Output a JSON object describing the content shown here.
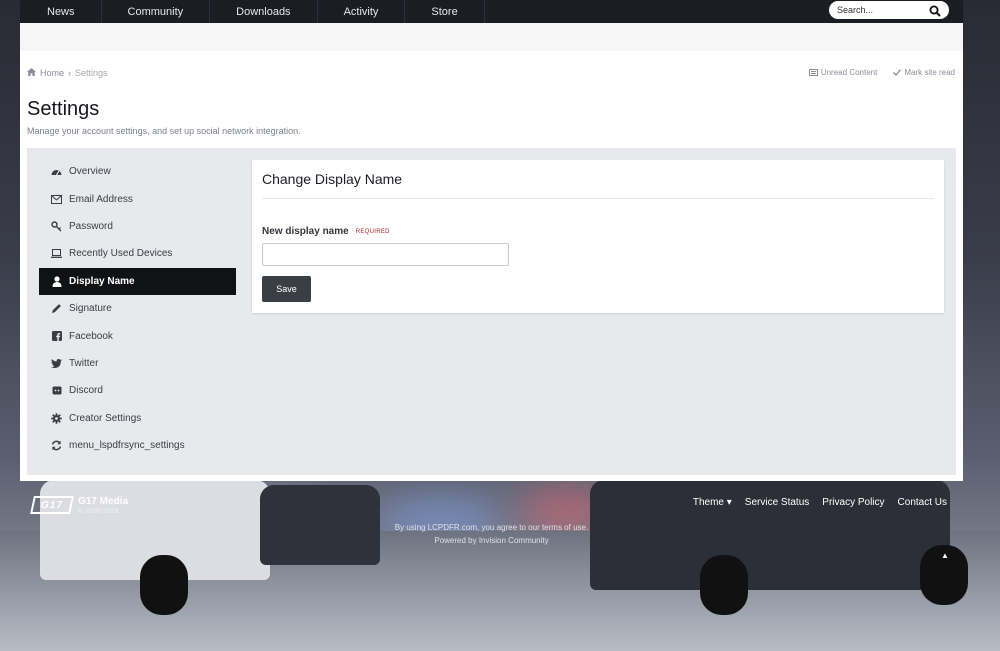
{
  "nav": {
    "items": [
      "News",
      "Community",
      "Downloads",
      "Activity",
      "Store"
    ],
    "search_placeholder": "Search..."
  },
  "breadcrumb": {
    "home": "Home",
    "current": "Settings",
    "unread_content": "Unread Content",
    "mark_site_read": "Mark site read"
  },
  "page": {
    "title": "Settings",
    "description": "Manage your account settings, and set up social network integration."
  },
  "sidebar": {
    "items": [
      {
        "label": "Overview",
        "icon": "dashboard-icon"
      },
      {
        "label": "Email Address",
        "icon": "envelope-icon"
      },
      {
        "label": "Password",
        "icon": "key-icon"
      },
      {
        "label": "Recently Used Devices",
        "icon": "laptop-icon"
      },
      {
        "label": "Display Name",
        "icon": "user-icon",
        "active": true
      },
      {
        "label": "Signature",
        "icon": "pencil-icon"
      },
      {
        "label": "Facebook",
        "icon": "facebook-icon"
      },
      {
        "label": "Twitter",
        "icon": "twitter-icon"
      },
      {
        "label": "Discord",
        "icon": "discord-icon"
      },
      {
        "label": "Creator Settings",
        "icon": "gear-icon"
      },
      {
        "label": "menu_lspdfrsync_settings",
        "icon": "refresh-icon"
      }
    ]
  },
  "form": {
    "title": "Change Display Name",
    "field_label": "New display name",
    "required_tag": "REQUIRED",
    "value": "",
    "save_label": "Save"
  },
  "footer": {
    "logo_text": "G17",
    "brand": "G17 Media",
    "copyright": "© 2009-2018.",
    "links": [
      "Theme ▾",
      "Service Status",
      "Privacy Policy",
      "Contact Us"
    ],
    "terms_note": "By using LCPDFR.com, you agree to our terms of use.",
    "powered_by": "Powered by Invision Community"
  },
  "colors": {
    "nav_bg": "#1b1d24",
    "active_item_bg": "#111214",
    "required": "#b0252a",
    "button_bg": "#3b3e45"
  }
}
